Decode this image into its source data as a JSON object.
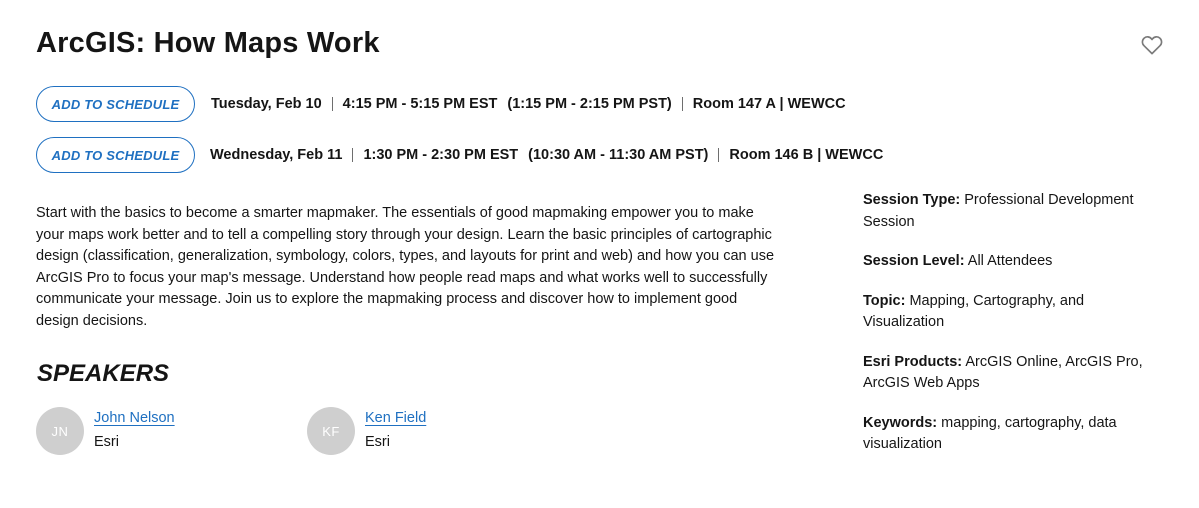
{
  "session": {
    "title": "ArcGIS: How Maps Work",
    "favorite_icon": "heart-outline-icon"
  },
  "schedule": [
    {
      "button_label": "ADD TO SCHEDULE",
      "date": "Tuesday, Feb 10",
      "time_est": "4:15 PM - 5:15 PM EST",
      "time_pst": "(1:15 PM - 2:15 PM PST)",
      "location": "Room 147 A | WEWCC"
    },
    {
      "button_label": "ADD TO SCHEDULE",
      "date": "Wednesday, Feb 11",
      "time_est": "1:30 PM - 2:30 PM EST",
      "time_pst": "(10:30 AM - 11:30 AM PST)",
      "location": "Room 146 B | WEWCC"
    }
  ],
  "description": "Start with the basics to become a smarter mapmaker. The essentials of good mapmaking empower you to make your maps work better and to tell a compelling story through your design. Learn the basic principles of cartographic design (classification, generalization, symbology, colors, types, and layouts for print and web) and how you can use ArcGIS Pro to focus your map's message. Understand how people read maps and what works well to successfully communicate your message. Join us to explore the mapmaking process and discover how to implement good design decisions.",
  "speakers": {
    "heading": "SPEAKERS",
    "list": [
      {
        "initials": "JN",
        "name": "John Nelson",
        "org": "Esri"
      },
      {
        "initials": "KF",
        "name": "Ken Field",
        "org": "Esri"
      }
    ]
  },
  "meta": [
    {
      "key": "Session Type:",
      "value": "Professional Development Session"
    },
    {
      "key": "Session Level:",
      "value": "All Attendees"
    },
    {
      "key": "Topic:",
      "value": "Mapping, Cartography, and Visualization"
    },
    {
      "key": "Esri Products:",
      "value": "ArcGIS Online, ArcGIS Pro, ArcGIS Web Apps"
    },
    {
      "key": "Keywords:",
      "value": "mapping, cartography, data visualization"
    }
  ],
  "colors": {
    "accent": "#1f70c1",
    "text": "#151515",
    "avatar_bg": "#cfcfcf"
  }
}
